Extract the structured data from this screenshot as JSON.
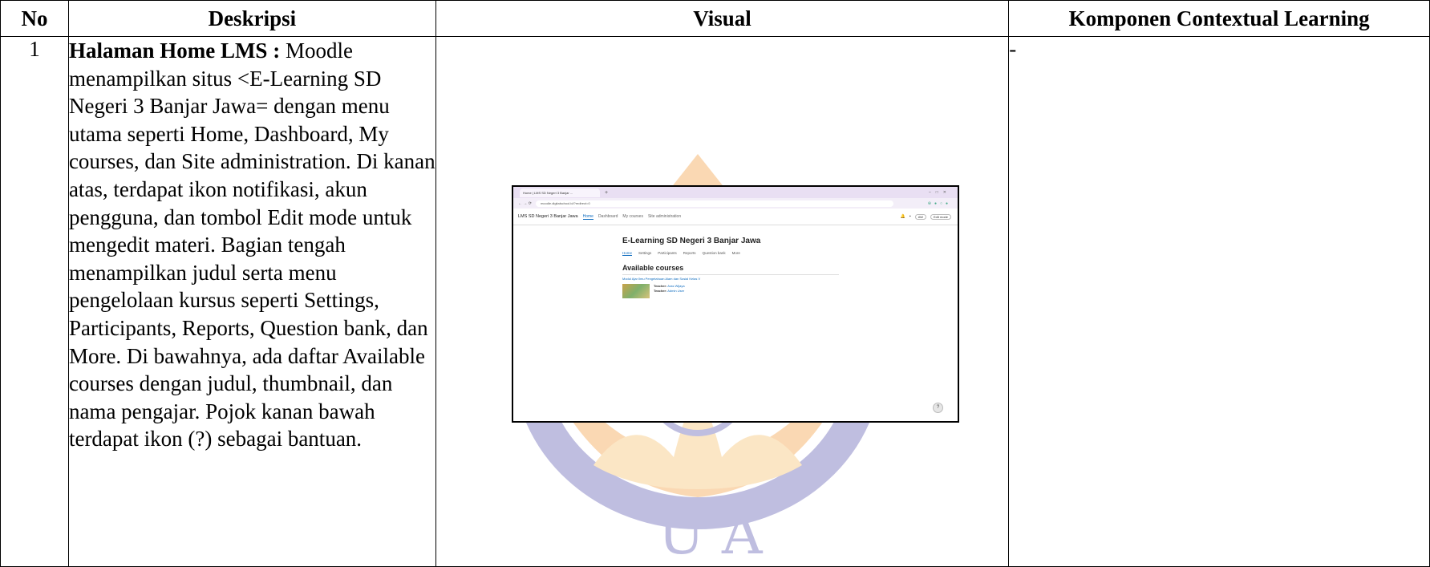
{
  "table": {
    "headers": {
      "no": "No",
      "deskripsi": "Deskripsi",
      "visual": "Visual",
      "komponen": "Komponen Contextual Learning"
    },
    "rows": [
      {
        "no": "1",
        "title": "Halaman Home LMS :",
        "description": " Moodle menampilkan situs <E-Learning SD Negeri 3 Banjar Jawa= dengan menu utama seperti Home, Dashboard, My courses, dan Site administration. Di kanan atas, terdapat ikon notifikasi, akun pengguna, dan tombol Edit mode untuk mengedit materi. Bagian tengah menampilkan judul serta menu pengelolaan kursus seperti Settings, Participants, Reports, Question bank, dan More. Di bawahnya, ada daftar Available courses dengan judul, thumbnail, dan nama pengajar. Pojok kanan bawah terdapat ikon (?) sebagai bantuan.",
        "komponen": "-"
      }
    ]
  },
  "screenshot": {
    "tab_title": "Home | LMS SD Negeri 3 Banjar ...",
    "url": "moodle.digitalschool.id/?redirect=0",
    "brand": "LMS SD Negeri 3 Banjar Jawa",
    "nav": [
      "Home",
      "Dashboard",
      "My courses",
      "Site administration"
    ],
    "user": "AW",
    "edit_mode": "Edit mode",
    "site_title": "E-Learning SD Negeri 3 Banjar Jawa",
    "course_tabs": [
      "Home",
      "Settings",
      "Participants",
      "Reports",
      "Question bank",
      "More"
    ],
    "available_heading": "Available courses",
    "course_name": "Modul Ajar Ilmu Pengetahuan Alam dan Sosial Kelas V",
    "teacher1_label": "Teacher:",
    "teacher1": "Aras Wijaya",
    "teacher2_label": "Teacher:",
    "teacher2": "Admin User",
    "help": "?"
  },
  "colors": {
    "link": "#0f6cbf",
    "watermark_orange": "#f39a3a",
    "watermark_purple": "#5a56b0"
  }
}
